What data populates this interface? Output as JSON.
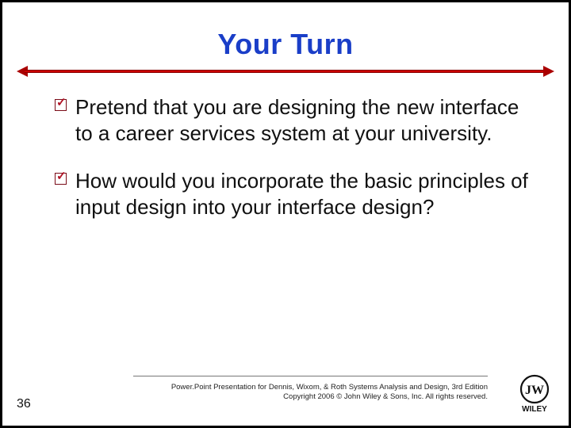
{
  "title": "Your Turn",
  "bullets": [
    "Pretend that you are designing the new interface to a career services system at your university.",
    "How would you incorporate the basic principles of input design into your interface design?"
  ],
  "credits": {
    "line1": "Power.Point Presentation for Dennis, Wixom, & Roth Systems Analysis and Design, 3rd Edition",
    "line2": "Copyright 2006 © John Wiley & Sons, Inc.  All rights reserved."
  },
  "page_number": "36",
  "logo_label": "WILEY"
}
